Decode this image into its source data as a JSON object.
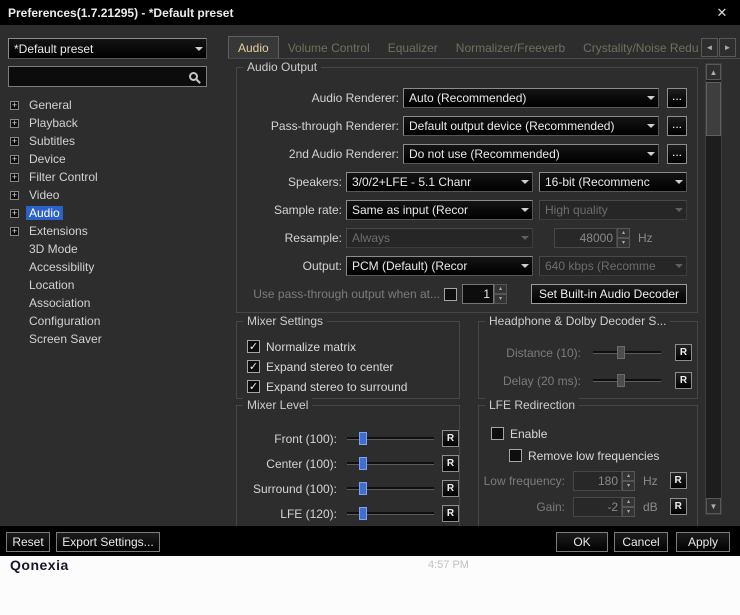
{
  "icons": {
    "close": "✕",
    "plus": "+",
    "check": "✓",
    "more": "...",
    "arrow_up": "▲",
    "arrow_down": "▼",
    "arrow_left": "◄",
    "arrow_right": "►",
    "spin_up": "▴",
    "spin_down": "▾"
  },
  "window": {
    "title": "Preferences(1.7.21295) - *Default preset"
  },
  "sidebar": {
    "preset_value": "*Default preset",
    "search_value": "",
    "tree": [
      {
        "label": "General",
        "expandable": true
      },
      {
        "label": "Playback",
        "expandable": true
      },
      {
        "label": "Subtitles",
        "expandable": true
      },
      {
        "label": "Device",
        "expandable": true
      },
      {
        "label": "Filter Control",
        "expandable": true
      },
      {
        "label": "Video",
        "expandable": true
      },
      {
        "label": "Audio",
        "expandable": true,
        "selected": true
      },
      {
        "label": "Extensions",
        "expandable": true
      },
      {
        "label": "3D Mode",
        "expandable": false
      },
      {
        "label": "Accessibility",
        "expandable": false
      },
      {
        "label": "Location",
        "expandable": false
      },
      {
        "label": "Association",
        "expandable": false
      },
      {
        "label": "Configuration",
        "expandable": false
      },
      {
        "label": "Screen Saver",
        "expandable": false
      }
    ]
  },
  "tabs": [
    {
      "label": "Audio",
      "active": true
    },
    {
      "label": "Volume Control"
    },
    {
      "label": "Equalizer"
    },
    {
      "label": "Normalizer/Freeverb"
    },
    {
      "label": "Crystality/Noise Redu"
    }
  ],
  "audio_output": {
    "title": "Audio Output",
    "audio_renderer": {
      "label": "Audio Renderer:",
      "value": "Auto (Recommended)"
    },
    "passthrough_renderer": {
      "label": "Pass-through Renderer:",
      "value": "Default output device (Recommended)"
    },
    "second_renderer": {
      "label": "2nd Audio Renderer:",
      "value": "Do not use (Recommended)"
    },
    "speakers": {
      "label": "Speakers:",
      "value": "3/0/2+LFE - 5.1 Chanr",
      "format": "16-bit (Recommenc"
    },
    "sample_rate": {
      "label": "Sample rate:",
      "value": "Same as input (Recor",
      "quality": "High quality"
    },
    "resample": {
      "label": "Resample:",
      "value": "Always",
      "rate": "48000",
      "unit": "Hz"
    },
    "output": {
      "label": "Output:",
      "value": "PCM (Default) (Recor",
      "bitrate": "640 kbps (Recomme"
    },
    "passthrough_when": {
      "label": "Use pass-through output when at...",
      "checked": false,
      "value": "1",
      "button": "Set Built-in Audio Decoder"
    }
  },
  "mixer_settings": {
    "title": "Mixer Settings",
    "options": [
      {
        "label": "Normalize matrix",
        "checked": true
      },
      {
        "label": "Expand stereo to center",
        "checked": true
      },
      {
        "label": "Expand stereo to surround",
        "checked": true
      }
    ]
  },
  "headphone": {
    "title": "Headphone & Dolby Decoder S...",
    "rows": [
      {
        "label": "Distance (10):",
        "reset": "R"
      },
      {
        "label": "Delay (20 ms):",
        "reset": "R"
      }
    ]
  },
  "mixer_level": {
    "title": "Mixer Level",
    "rows": [
      {
        "label": "Front (100):",
        "reset": "R"
      },
      {
        "label": "Center (100):",
        "reset": "R"
      },
      {
        "label": "Surround (100):",
        "reset": "R"
      },
      {
        "label": "LFE (120):",
        "reset": "R"
      }
    ]
  },
  "lfe_redirection": {
    "title": "LFE Redirection",
    "enable": {
      "label": "Enable",
      "checked": false
    },
    "remove_low": {
      "label": "Remove low frequencies",
      "checked": false
    },
    "low_frequency": {
      "label": "Low frequency:",
      "value": "180",
      "unit": "Hz",
      "reset": "R"
    },
    "gain": {
      "label": "Gain:",
      "value": "-2",
      "unit": "dB",
      "reset": "R"
    }
  },
  "footer": {
    "reset": "Reset",
    "export": "Export Settings...",
    "ok": "OK",
    "cancel": "Cancel",
    "apply": "Apply"
  },
  "desktop": {
    "brand": "Qonexia",
    "time": "4:57 PM"
  },
  "colors": {
    "accent_blue": "#2a62c9",
    "slider_thumb": "#3e6ed2",
    "tab_active_text": "#e3cf9c",
    "dialog_bg": "#2d2d2d"
  }
}
